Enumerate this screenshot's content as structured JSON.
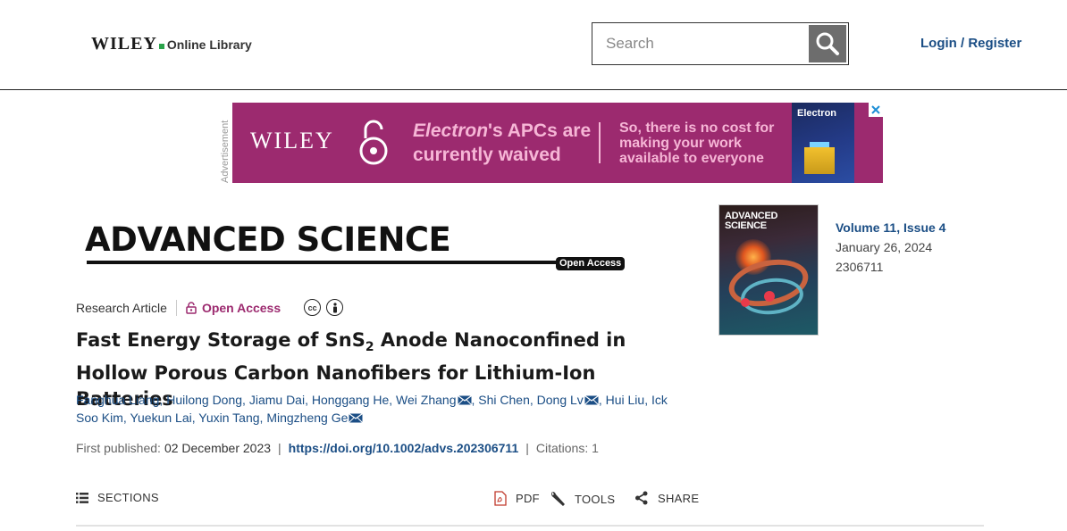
{
  "header": {
    "logo_brand": "WILEY",
    "logo_suffix": "Online Library",
    "search_placeholder": "Search",
    "search_icon": "search-icon",
    "login_label": "Login / Register"
  },
  "ad": {
    "label": "Advertisement",
    "brand": "WILEY",
    "headline_italic": "Electron",
    "headline_rest": "'s APCs are",
    "headline_line2": "currently waived",
    "sub_line1": "So, there is no cost for",
    "sub_line2": "making your work",
    "sub_line3": "available to everyone",
    "cover_title": "Electron",
    "colors": {
      "background": "#9c2a6f",
      "text": "#f6b6d6"
    }
  },
  "journal": {
    "title": "ADVANCED SCIENCE",
    "badge": "Open Access"
  },
  "article": {
    "type": "Research Article",
    "access": "Open Access",
    "title_part1": "Fast Energy Storage of SnS",
    "title_sub": "2",
    "title_part2": " Anode Nanoconfined in Hollow Porous Carbon Nanofibers for Lithium-Ion Batteries",
    "authors": [
      {
        "name": "Fanghua Liang",
        "mail": false
      },
      {
        "name": "Huilong Dong",
        "mail": false
      },
      {
        "name": "Jiamu Dai",
        "mail": false
      },
      {
        "name": "Honggang He",
        "mail": false
      },
      {
        "name": "Wei Zhang",
        "mail": true
      },
      {
        "name": "Shi Chen",
        "mail": false
      },
      {
        "name": "Dong Lv",
        "mail": true
      },
      {
        "name": "Hui Liu",
        "mail": false
      },
      {
        "name": "Ick Soo Kim",
        "mail": false
      },
      {
        "name": "Yuekun Lai",
        "mail": false
      },
      {
        "name": "Yuxin Tang",
        "mail": false
      },
      {
        "name": "Mingzheng Ge",
        "mail": true
      }
    ],
    "first_published_label": "First published:",
    "first_published_date": "02 December 2023",
    "doi": "https://doi.org/10.1002/advs.202306711",
    "citations": "Citations: 1"
  },
  "issue": {
    "cover_title_1": "ADVANCED",
    "cover_title_2": "SCIENCE",
    "volume": "Volume 11, Issue 4",
    "date": "January 26, 2024",
    "article_number": "2306711"
  },
  "toolbar": {
    "sections": "SECTIONS",
    "pdf": "PDF",
    "tools": "TOOLS",
    "share": "SHARE"
  }
}
